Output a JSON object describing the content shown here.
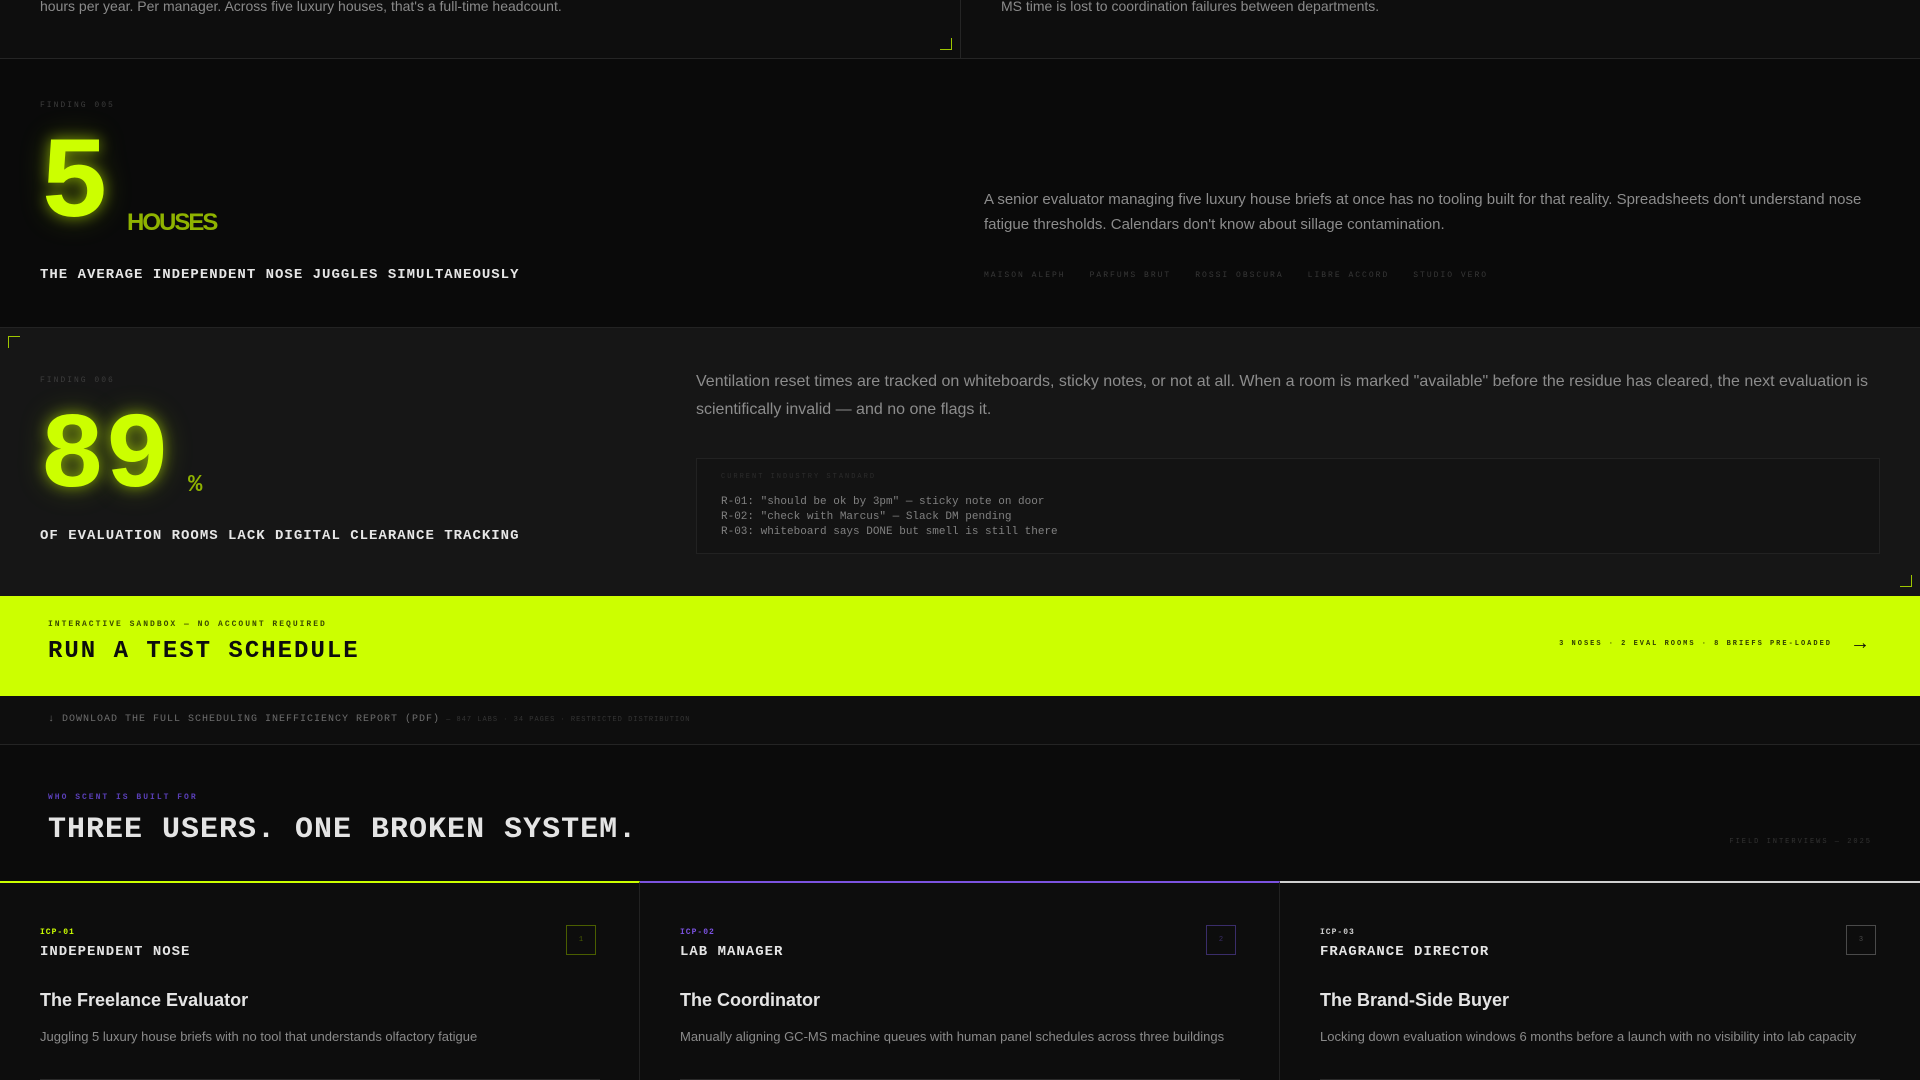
{
  "top_strip": {
    "left_text": "hours per year. Per manager. Across five luxury houses, that's a full-time headcount.",
    "right_text": "MS time is lost to coordination failures between departments."
  },
  "finding_005": {
    "label": "FINDING 005",
    "number": "5",
    "unit": "HOUSES",
    "caption": "THE AVERAGE INDEPENDENT NOSE JUGGLES SIMULTANEOUSLY",
    "description": "A senior evaluator managing five luxury house briefs at once has no tooling built for that reality. Spreadsheets don't understand nose fatigue thresholds. Calendars don't know about sillage contamination.",
    "houses": [
      "MAISON ALEPH",
      "PARFUMS BRUT",
      "ROSSI OBSCURA",
      "LIBRE ACCORD",
      "STUDIO VERO"
    ]
  },
  "finding_006": {
    "label": "FINDING 006",
    "number": "89",
    "unit": "%",
    "caption": "OF EVALUATION ROOMS LACK DIGITAL CLEARANCE TRACKING",
    "description": "Ventilation reset times are tracked on whiteboards, sticky notes, or not at all. When a room is marked \"available\" before the residue has cleared, the next evaluation is scientifically invalid — and no one flags it.",
    "log_title": "CURRENT INDUSTRY STANDARD",
    "log_lines": [
      "R-01: \"should be ok by 3pm\" — sticky note on door",
      "R-02: \"check with Marcus\" — Slack DM pending",
      "R-03: whiteboard says DONE but smell is still there"
    ]
  },
  "cta": {
    "kicker": "INTERACTIVE SANDBOX — NO ACCOUNT REQUIRED",
    "title": "RUN A TEST SCHEDULE",
    "meta": "3 NOSES · 2 EVAL ROOMS · 8 BRIEFS PRE-LOADED",
    "arrow": "→"
  },
  "download": {
    "label": "↓ DOWNLOAD THE FULL SCHEDULING INEFFICIENCY REPORT (PDF)",
    "meta": "— 847 LABS · 34 PAGES · RESTRICTED DISTRIBUTION"
  },
  "users": {
    "kicker": "WHO SCENT IS BUILT FOR",
    "heading": "THREE USERS. ONE BROKEN SYSTEM.",
    "interviews": "FIELD INTERVIEWS — 2025",
    "cards": [
      {
        "code": "ICP-01",
        "role": "INDEPENDENT NOSE",
        "persona": "The Freelance Evaluator",
        "desc": "Juggling 5 luxury house briefs with no tool that understands olfactory fatigue",
        "badge": "1",
        "accent": "#ccff00"
      },
      {
        "code": "ICP-02",
        "role": "LAB MANAGER",
        "persona": "The Coordinator",
        "desc": "Manually aligning GC-MS machine queues with human panel schedules across three buildings",
        "badge": "2",
        "accent": "#7b52e0"
      },
      {
        "code": "ICP-03",
        "role": "FRAGRANCE DIRECTOR",
        "persona": "The Brand-Side Buyer",
        "desc": "Locking down evaluation windows 6 months before a launch with no visibility into lab capacity",
        "badge": "3",
        "accent": "#cfcfcf"
      }
    ]
  }
}
